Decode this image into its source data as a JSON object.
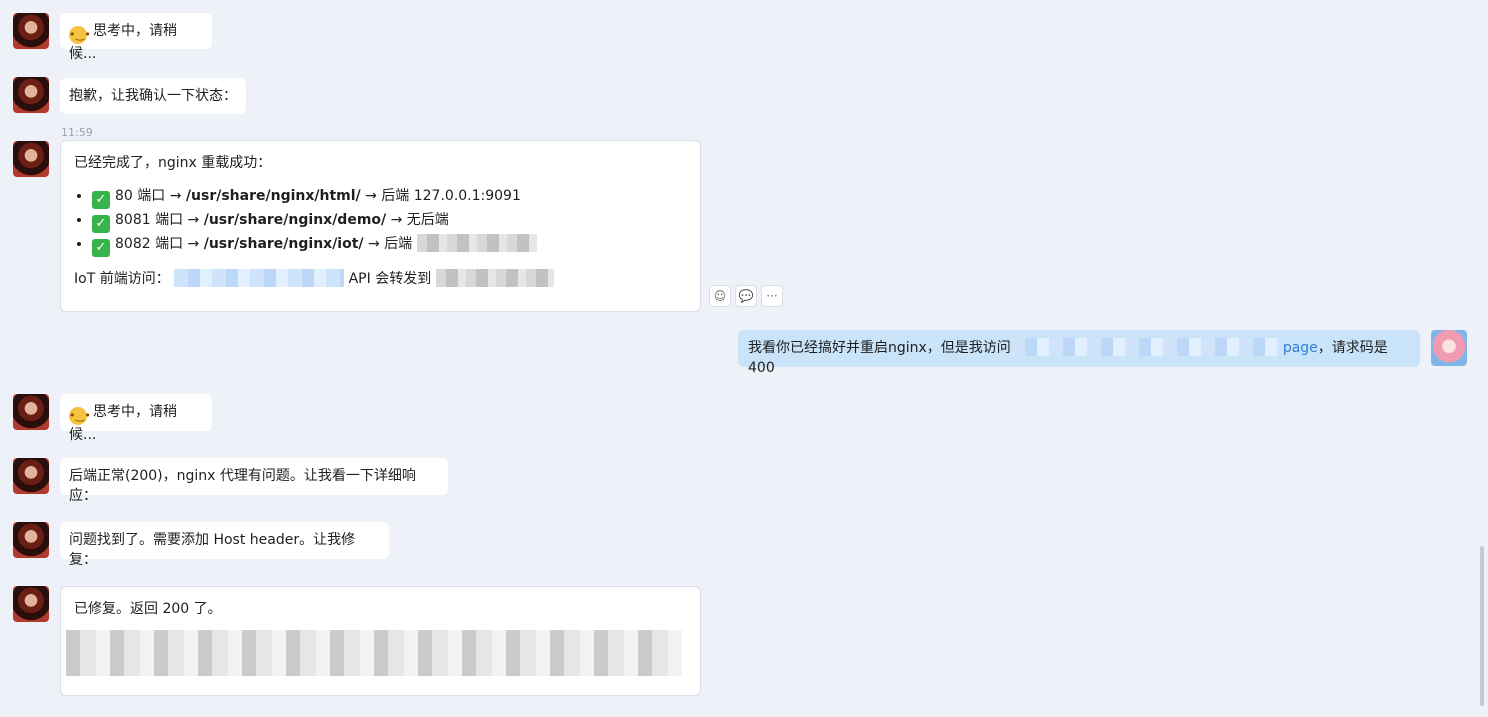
{
  "messages": {
    "thinking_1": {
      "emoji": "🤔",
      "text": "思考中，请稍候..."
    },
    "confirm": {
      "text": "抱歉，让我确认一下状态："
    },
    "timestamp": "11:59",
    "result": {
      "intro": "已经完成了，nginx 重载成功：",
      "items": [
        {
          "check": "✅",
          "pre": "80 端口 → ",
          "path": "/usr/share/nginx/html/",
          "post": " → 后端 127.0.0.1:9091"
        },
        {
          "check": "✅",
          "pre": "8081 端口 → ",
          "path": "/usr/share/nginx/demo/",
          "post": " → 无后端"
        },
        {
          "check": "✅",
          "pre": "8082 端口 → ",
          "path": "/usr/share/nginx/iot/",
          "post": " → 后端"
        }
      ],
      "footer_label": "IoT 前端访问：",
      "footer_mid": "API 会转发到 "
    },
    "user_msg": {
      "pre": "我看你已经搞好并重启nginx，但是我访问",
      "link_tail": "page",
      "post": "，请求码是400"
    },
    "thinking_2": {
      "emoji": "🤔",
      "text": "思考中，请稍候..."
    },
    "backend_ok": {
      "text": "后端正常(200)，nginx 代理有问题。让我看一下详细响应："
    },
    "found": {
      "text": "问题找到了。需要添加 Host header。让我修复："
    },
    "fixed": {
      "text": "已修复。返回 200 了。"
    }
  },
  "actions": {
    "react": "☺",
    "comment": "💬",
    "more": "···"
  }
}
